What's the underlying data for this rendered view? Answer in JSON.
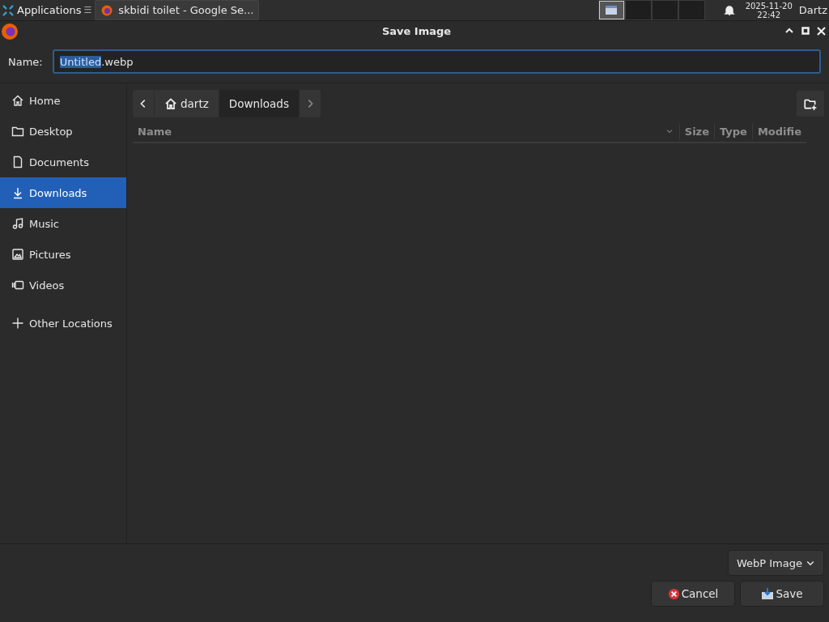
{
  "taskbar": {
    "menu": "Applications",
    "menu_glyph": "☰",
    "task": "skbidi toilet - Google Se...",
    "workspaces": [
      {
        "selected": true
      },
      {
        "selected": false
      },
      {
        "selected": false
      },
      {
        "selected": false
      }
    ],
    "clock_date": "2025-11-20",
    "clock_time": "22:42",
    "user": "Dartz"
  },
  "window": {
    "title": "Save Image"
  },
  "name_field": {
    "label": "Name:",
    "selected_part": "Untitled",
    "rest": ".webp"
  },
  "sidebar": {
    "items": [
      {
        "label": "Home",
        "kind": "home",
        "selected": false
      },
      {
        "label": "Desktop",
        "kind": "folder",
        "selected": false
      },
      {
        "label": "Documents",
        "kind": "document",
        "selected": false
      },
      {
        "label": "Downloads",
        "kind": "download",
        "selected": true
      },
      {
        "label": "Music",
        "kind": "music",
        "selected": false
      },
      {
        "label": "Pictures",
        "kind": "picture",
        "selected": false
      },
      {
        "label": "Videos",
        "kind": "video",
        "selected": false
      },
      {
        "label": "Other Locations",
        "kind": "plus",
        "selected": false
      }
    ]
  },
  "path": [
    {
      "label": "dartz",
      "home": true,
      "selected": false
    },
    {
      "label": "Downloads",
      "home": false,
      "selected": true
    }
  ],
  "columns": [
    {
      "label": "Name",
      "sorted": true
    },
    {
      "label": "Size",
      "sorted": false
    },
    {
      "label": "Type",
      "sorted": false
    },
    {
      "label": "Modifie",
      "sorted": false
    }
  ],
  "filter": "WebP Image",
  "buttons": [
    {
      "label": "Cancel",
      "kind": "cancel"
    },
    {
      "label": "Save",
      "kind": "save"
    }
  ]
}
